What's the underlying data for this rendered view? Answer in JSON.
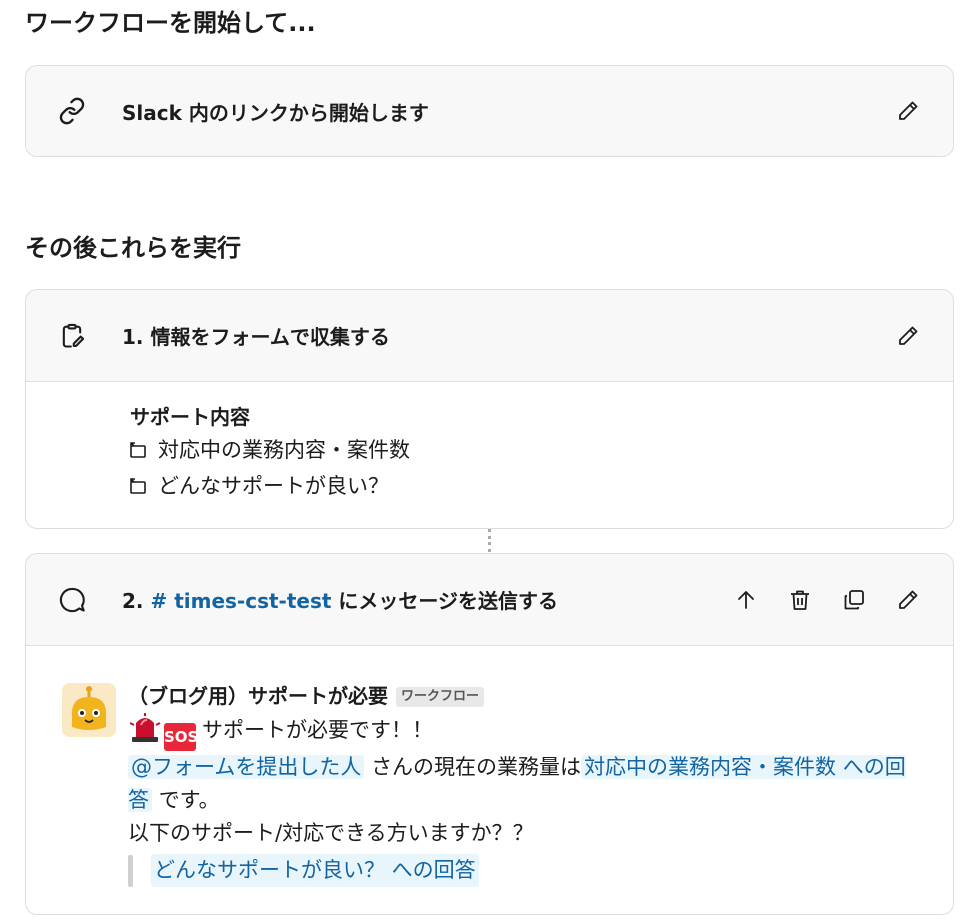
{
  "trigger_section": {
    "title": "ワークフローを開始して...",
    "card_title": "Slack 内のリンクから開始します",
    "icon": "link-icon"
  },
  "steps_section": {
    "title": "その後これらを実行"
  },
  "step1": {
    "title": "1. 情報をフォームで収集する",
    "icon": "form-icon",
    "form_title": "サポート内容",
    "fields": [
      "対応中の業務内容・案件数",
      "どんなサポートが良い？"
    ]
  },
  "step2": {
    "prefix": "2.",
    "channel": "# times-cst-test",
    "suffix": "にメッセージを送信する",
    "icon": "message-icon",
    "message": {
      "sender": "（ブログ用）サポートが必要",
      "badge": "ワークフロー",
      "sos_label": "SOS",
      "line1": "サポートが必要です！！",
      "mention": "@フォームを提出した人",
      "text_a": "さんの現在の業務量は",
      "var1": "対応中の業務内容・案件数 への回答",
      "text_b": "です。",
      "line3": "以下のサポート/対応できる方いますか？？",
      "quote_var": "どんなサポートが良い？ への回答"
    }
  },
  "colors": {
    "link": "#1264a3",
    "var_bg": "#e8f5fa",
    "header_bg": "#f8f8f8",
    "border": "#dddddd"
  }
}
